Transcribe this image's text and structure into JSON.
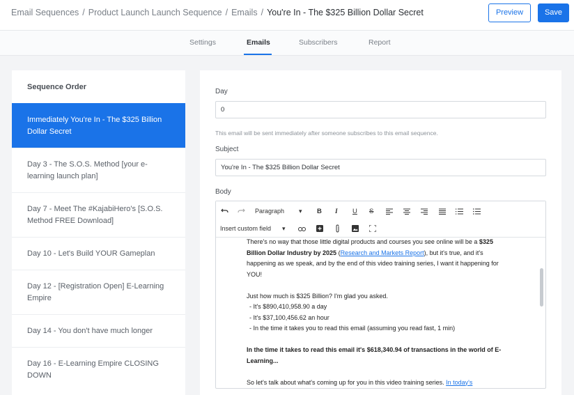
{
  "breadcrumb": {
    "item1": "Email Sequences",
    "item2": "Product Launch Launch Sequence",
    "item3": "Emails",
    "current": "You're In - The $325 Billion Dollar Secret",
    "separator": "/"
  },
  "actions": {
    "preview": "Preview",
    "save": "Save"
  },
  "tabs": {
    "settings": "Settings",
    "emails": "Emails",
    "subscribers": "Subscribers",
    "report": "Report"
  },
  "sequence": {
    "title": "Sequence Order",
    "items": [
      "Immediately You're In - The $325 Billion Dollar Secret",
      "Day 3 - The S.O.S. Method [your e-learning launch plan]",
      "Day 7 - Meet The #KajabiHero's [S.O.S. Method FREE Download]",
      "Day 10 - Let's Build YOUR Gameplan",
      "Day 12 - [Registration Open] E-Learning Empire",
      "Day 14 - You don't have much longer",
      "Day 16 - E-Learning Empire CLOSING DOWN"
    ]
  },
  "form": {
    "day_label": "Day",
    "day_value": "0",
    "day_hint": "This email will be sent immediately after someone subscribes to this email sequence.",
    "subject_label": "Subject",
    "subject_value": "You're In - The $325 Billion Dollar Secret",
    "body_label": "Body"
  },
  "toolbar": {
    "block_format": "Paragraph",
    "dropdown_arrow": "▾",
    "insert_field": "Insert custom field",
    "bold": "B",
    "italic": "I",
    "underline": "U",
    "strike": "S"
  },
  "body": {
    "p1_a": "There's no way that those little digital products and courses you see online will be a",
    "p1_bold": "$325 Billion Dollar Industry by 2025",
    "p1_b": "(",
    "p1_link": "Research and Markets Report",
    "p1_c": "), but it's true, and it's happening as we speak, and by the end of this video training series, I want it happening for YOU!",
    "p2": "Just how much is $325 Billion? I'm glad you asked.",
    "li1": "- It's $890,410,958.90 a day",
    "li2": "- It's $37,100,456.62 an hour",
    "li3": "- In the time it takes you to read this email (assuming you read fast, 1 min)",
    "p3": "In the time it takes to read this email it's $618,340.94 of transactions in the world of E-Learning...",
    "p4": "So let's talk about what's coming up for you in this video training series.",
    "p4_link": "In today's"
  },
  "colors": {
    "accent": "#1a73e8",
    "background": "#f3f4f6",
    "panel": "#ffffff"
  },
  "icons": [
    "undo-icon",
    "redo-icon",
    "link-icon",
    "add-block-icon",
    "attachment-icon",
    "image-icon",
    "fullscreen-icon",
    "align-left-icon",
    "align-center-icon",
    "align-right-icon",
    "align-justify-icon",
    "numbered-list-icon",
    "bulleted-list-icon"
  ]
}
